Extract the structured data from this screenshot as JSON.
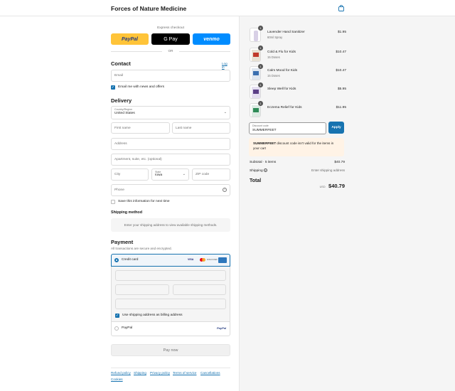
{
  "header": {
    "store_name": "Forces of Nature Medicine",
    "cart_icon": "bag-icon"
  },
  "express": {
    "label": "Express checkout",
    "paypal": "PayPal",
    "gpay": "G Pay",
    "venmo": "venmo",
    "or": "OR"
  },
  "contact": {
    "title": "Contact",
    "login": "Log in",
    "email_placeholder": "Email",
    "news_label": "Email me with news and offers",
    "news_checked": true
  },
  "delivery": {
    "title": "Delivery",
    "country_label": "Country/Region",
    "country_value": "United States",
    "first_name": "First name",
    "last_name": "Last name",
    "address": "Address",
    "apartment": "Apartment, suite, etc. (optional)",
    "city": "City",
    "state_label": "State",
    "state_value": "Iowa",
    "zip": "ZIP code",
    "phone": "Phone",
    "save_label": "Save this information for next time"
  },
  "shipping_method": {
    "title": "Shipping method",
    "message": "Enter your shipping address to view available shipping methods."
  },
  "payment": {
    "title": "Payment",
    "subtitle": "All transactions are secure and encrypted.",
    "credit_card": "Credit card",
    "card_brands": [
      "VISA",
      "MC",
      "DISCOVER",
      "AMEX"
    ],
    "billing_label": "Use shipping address as billing address",
    "paypal_option": "PayPal",
    "paypal_logo": "PayPal",
    "pay_now": "Pay now"
  },
  "footer": {
    "links": [
      "Refund policy",
      "Shipping",
      "Privacy policy",
      "Terms of service",
      "Cancellations",
      "Cookies"
    ]
  },
  "cart": {
    "items": [
      {
        "name": "Lavender Hand Sanitizer",
        "sub": "60ml Spray",
        "price": "$1.95",
        "qty": "1",
        "color": "#7b5ea7"
      },
      {
        "name": "Cold & Flu for Kids",
        "sub": "15 Doses",
        "price": "$10.47",
        "qty": "1",
        "color": "#c0392b"
      },
      {
        "name": "Calm Mood for Kids",
        "sub": "15 Doses",
        "price": "$10.47",
        "qty": "1",
        "color": "#3a6fb0"
      },
      {
        "name": "Sleep Well for Kids",
        "sub": "",
        "price": "$5.95",
        "qty": "1",
        "color": "#5b3f86"
      },
      {
        "name": "Eczema Relief for Kids",
        "sub": "",
        "price": "$11.95",
        "qty": "1",
        "color": "#2e8b57"
      }
    ],
    "discount_label": "Discount code",
    "discount_value": "SUMMERFEET",
    "apply": "Apply",
    "error_code": "SUMMERFEET",
    "error_text": " discount code isn't valid for the items in your cart",
    "subtotal_label": "Subtotal · 5 items",
    "subtotal_value": "$40.79",
    "shipping_label": "Shipping",
    "shipping_value": "Enter shipping address",
    "total_label": "Total",
    "currency": "USD",
    "total_value": "$40.79"
  },
  "colors": {
    "accent": "#1773b0",
    "paypal_yellow": "#ffc439",
    "venmo_blue": "#008cff",
    "error_bg": "#fff3e6"
  }
}
